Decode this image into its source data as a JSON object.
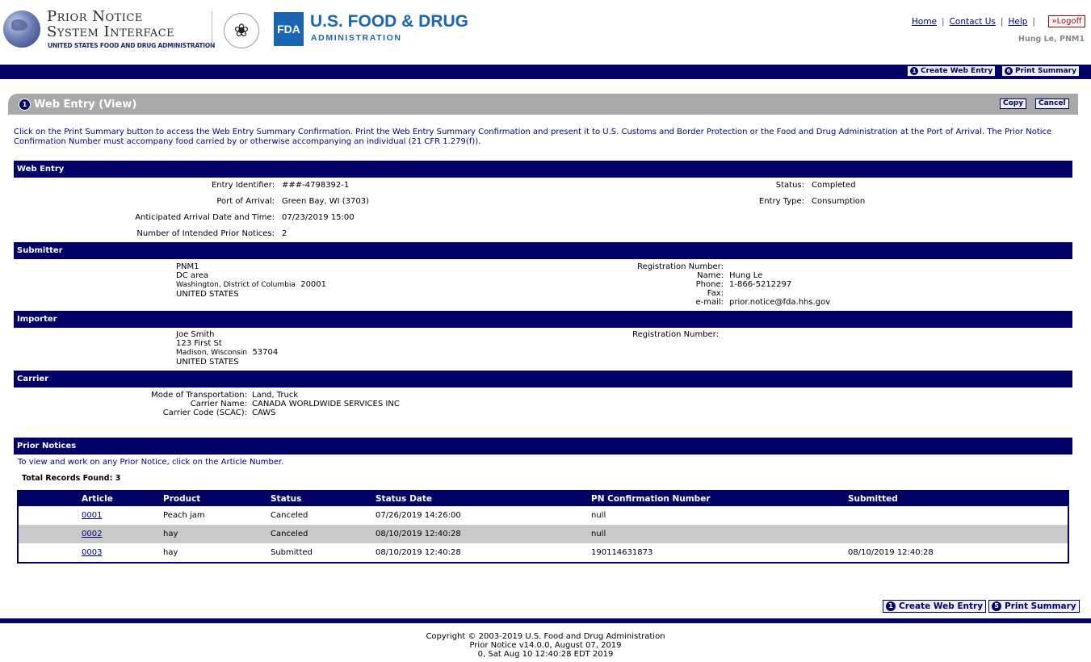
{
  "header": {
    "logo_title_line1": "Prior Notice",
    "logo_title_line2": "System Interface",
    "logo_subtitle": "UNITED STATES FOOD AND DRUG ADMINISTRATION",
    "fda_mark": "FDA",
    "fda_name": "U.S. FOOD & DRUG",
    "fda_admin": "ADMINISTRATION",
    "links": {
      "home": "Home",
      "contact": "Contact Us",
      "help": "Help",
      "sep": "|"
    },
    "logoff": "»Logoff",
    "user": "Hung Le, PNM1"
  },
  "nav": {
    "create": {
      "num": "1",
      "label": "Create Web Entry"
    },
    "print": {
      "num": "6",
      "label": "Print Summary"
    }
  },
  "page": {
    "title_num": "1",
    "title": "Web Entry (View)",
    "copy": "Copy",
    "cancel": "Cancel",
    "intro": "Click on the Print Summary button to access the Web Entry Summary Confirmation. Print the Web Entry Summary Confirmation and present it to U.S. Customs and Border Protection or the Food and Drug Administration at the Port of Arrival. The Prior Notice Confirmation Number must accompany food carried by or otherwise accompanying an individual (21 CFR 1.279(f))."
  },
  "web_entry": {
    "heading": "Web Entry",
    "entry_identifier_label": "Entry Identifier:",
    "entry_identifier": "###-4798392-1",
    "port_label": "Port of Arrival:",
    "port": "Green Bay, WI (3703)",
    "arrival_label": "Anticipated Arrival Date and Time:",
    "arrival": "07/23/2019 15:00",
    "intended_label": "Number of Intended Prior Notices:",
    "intended": "2",
    "status_label": "Status:",
    "status": "Completed",
    "entry_type_label": "Entry Type:",
    "entry_type": "Consumption"
  },
  "submitter": {
    "heading": "Submitter",
    "line1": "PNM1",
    "line2": "DC area",
    "city": "Washington, ",
    "state": "District of Columbia",
    "zip": "20001",
    "country": "UNITED STATES",
    "reg_label": "Registration Number:",
    "name_label": "Name:",
    "name": "Hung Le",
    "phone_label": "Phone:",
    "phone": "1-866-5212297",
    "fax_label": "Fax:",
    "email_label": "e-mail:",
    "email": "prior.notice@fda.hhs.gov"
  },
  "importer": {
    "heading": "Importer",
    "line1": "Joe Smith",
    "line2": "123 First St",
    "city": "Madison, ",
    "state": "Wisconsin",
    "zip": "53704",
    "country": "UNITED STATES",
    "reg_label": "Registration Number:"
  },
  "carrier": {
    "heading": "Carrier",
    "mode_label": "Mode of Transportation:",
    "mode": "Land, Truck",
    "name_label": "Carrier Name:",
    "name": "CANADA WORLDWIDE SERVICES INC",
    "code_label": "Carrier Code (SCAC):",
    "code": "CAWS"
  },
  "prior_notices": {
    "heading": "Prior Notices",
    "instruction": "To view and work on any Prior Notice, click on the Article Number.",
    "total": "Total Records Found: 3",
    "columns": [
      "Article",
      "Product",
      "Status",
      "Status Date",
      "PN Confirmation Number",
      "Submitted"
    ],
    "rows": [
      {
        "article": "0001",
        "product": "Peach jam",
        "status": "Canceled",
        "status_date": "07/26/2019 14:26:00",
        "pn": "null",
        "submitted": ""
      },
      {
        "article": "0002",
        "product": "hay",
        "status": "Canceled",
        "status_date": "08/10/2019 12:40:28",
        "pn": "null",
        "submitted": ""
      },
      {
        "article": "0003",
        "product": "hay",
        "status": "Submitted",
        "status_date": "08/10/2019 12:40:28",
        "pn": "190114631873",
        "submitted": "08/10/2019 12:40:28"
      }
    ]
  },
  "bottom_buttons": {
    "create": {
      "num": "1",
      "label": "Create Web Entry"
    },
    "print": {
      "num": "5",
      "label": "Print Summary"
    }
  },
  "footer": {
    "line1": "Copyright © 2003-2019 U.S. Food and Drug Administration",
    "line2": "Prior Notice v14.0.0, August 07, 2019",
    "line3": "0, Sat Aug 10 12:40:28 EDT 2019"
  }
}
